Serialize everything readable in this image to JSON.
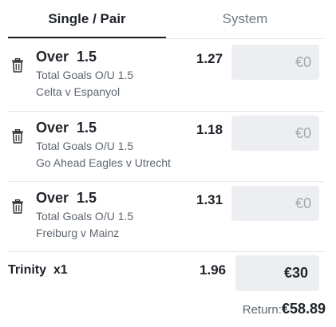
{
  "tabs": [
    {
      "label": "Single / Pair",
      "active": true
    },
    {
      "label": "System",
      "active": false
    }
  ],
  "bets": [
    {
      "selection": "Over  1.5",
      "market": "Total Goals O/U 1.5",
      "event": "Celta v Espanyol",
      "odds": "1.27",
      "stake": "€0",
      "icon": "trash-icon"
    },
    {
      "selection": "Over  1.5",
      "market": "Total Goals O/U 1.5",
      "event": "Go Ahead Eagles v Utrecht",
      "odds": "1.18",
      "stake": "€0",
      "icon": "trash-icon"
    },
    {
      "selection": "Over  1.5",
      "market": "Total Goals O/U 1.5",
      "event": "Freiburg v Mainz",
      "odds": "1.31",
      "stake": "€0",
      "icon": "trash-icon"
    }
  ],
  "combo": {
    "label": "Trinity  x1",
    "odds": "1.96",
    "stake": "€30"
  },
  "summary": {
    "return_label": "Return:",
    "return_value": "€58.89"
  },
  "colors": {
    "active_tab": "#1f2329",
    "inactive_tab": "#707780",
    "stake_bg": "#eceef1",
    "placeholder": "#a2a7ad"
  }
}
